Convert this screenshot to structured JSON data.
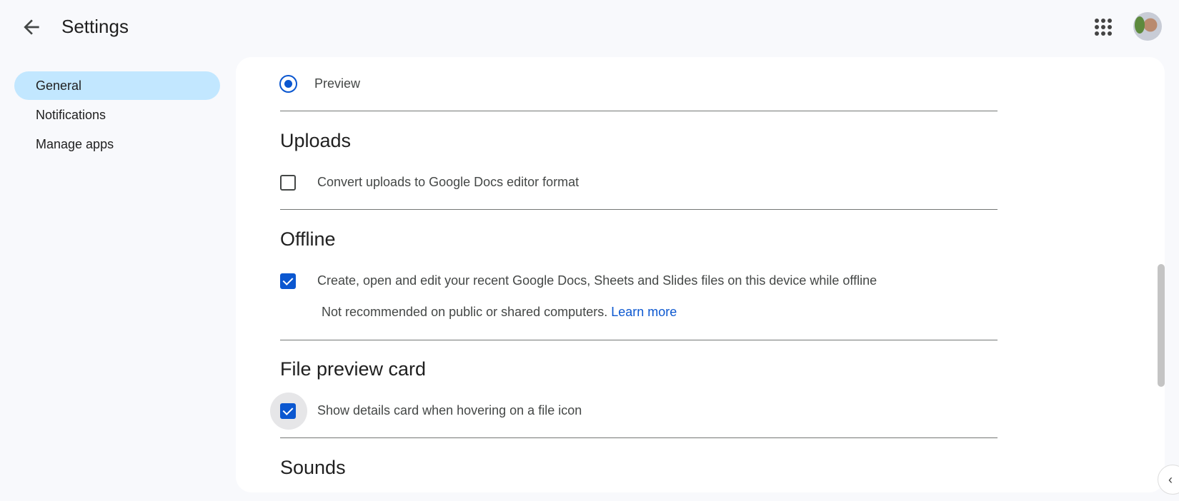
{
  "header": {
    "title": "Settings",
    "back_icon": "arrow-left-icon",
    "apps_icon": "apps-grid-icon",
    "avatar_icon": "account-avatar"
  },
  "sidebar": {
    "items": [
      {
        "label": "General",
        "selected": true
      },
      {
        "label": "Notifications"
      },
      {
        "label": "Manage apps"
      }
    ]
  },
  "main": {
    "preview_option": {
      "label": "Preview",
      "selected": true
    },
    "uploads": {
      "title": "Uploads",
      "convert_label": "Convert uploads to Google Docs editor format",
      "convert_checked": false
    },
    "offline": {
      "title": "Offline",
      "label": "Create, open and edit your recent Google Docs, Sheets and Slides files on this device while offline",
      "checked": true,
      "note": "Not recommended on public or shared computers.",
      "learn_more": "Learn more"
    },
    "file_preview": {
      "title": "File preview card",
      "label": "Show details card when hovering on a file icon",
      "checked": true
    },
    "sounds": {
      "title": "Sounds"
    }
  },
  "colors": {
    "accent": "#0b57d0",
    "selected_nav": "#c2e7ff"
  }
}
